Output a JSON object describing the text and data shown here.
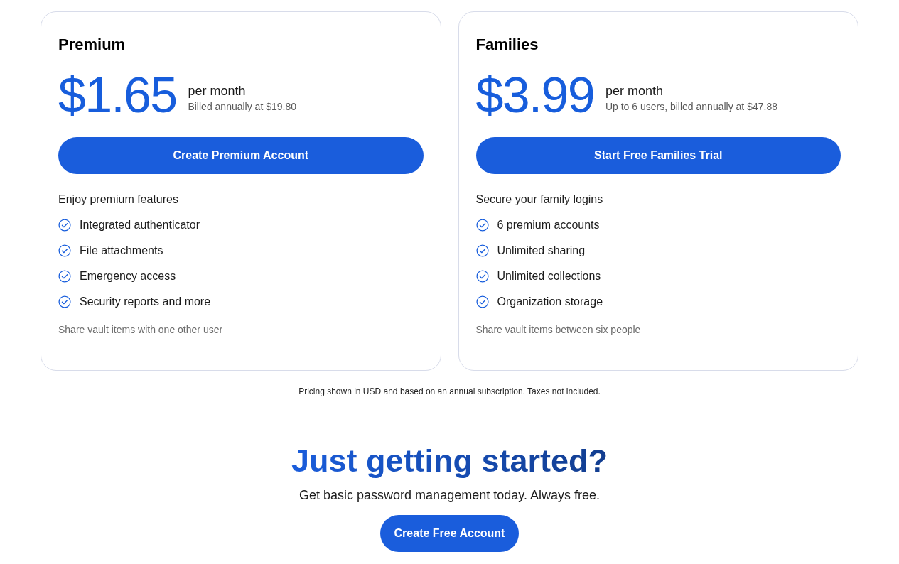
{
  "plans": [
    {
      "name": "Premium",
      "price": "$1.65",
      "period": "per month",
      "billing": "Billed annually at $19.80",
      "button": "Create Premium Account",
      "intro": "Enjoy premium features",
      "features": [
        "Integrated authenticator",
        "File attachments",
        "Emergency access",
        "Security reports and more"
      ],
      "note": "Share vault items with one other user"
    },
    {
      "name": "Families",
      "price": "$3.99",
      "period": "per month",
      "billing": "Up to 6 users, billed annually at $47.88",
      "button": "Start Free Families Trial",
      "intro": "Secure your family logins",
      "features": [
        "6 premium accounts",
        "Unlimited sharing",
        "Unlimited collections",
        "Organization storage"
      ],
      "note": "Share vault items between six people"
    }
  ],
  "disclaimer": "Pricing shown in USD and based on an annual subscription. Taxes not included.",
  "cta": {
    "heading": "Just getting started?",
    "subtitle": "Get basic password management today. Always free.",
    "button": "Create Free Account"
  }
}
